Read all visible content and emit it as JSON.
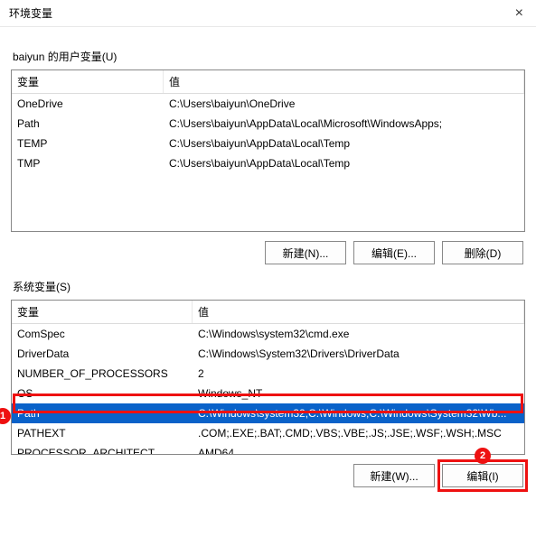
{
  "window": {
    "title": "环境变量",
    "close_glyph": "×"
  },
  "user_vars": {
    "group_label": "baiyun 的用户变量(U)",
    "headers": {
      "variable": "变量",
      "value": "值"
    },
    "rows": [
      {
        "variable": "OneDrive",
        "value": "C:\\Users\\baiyun\\OneDrive"
      },
      {
        "variable": "Path",
        "value": "C:\\Users\\baiyun\\AppData\\Local\\Microsoft\\WindowsApps;"
      },
      {
        "variable": "TEMP",
        "value": "C:\\Users\\baiyun\\AppData\\Local\\Temp"
      },
      {
        "variable": "TMP",
        "value": "C:\\Users\\baiyun\\AppData\\Local\\Temp"
      }
    ],
    "buttons": {
      "new": "新建(N)...",
      "edit": "编辑(E)...",
      "delete": "删除(D)"
    }
  },
  "system_vars": {
    "group_label": "系统变量(S)",
    "headers": {
      "variable": "变量",
      "value": "值"
    },
    "rows": [
      {
        "variable": "ComSpec",
        "value": "C:\\Windows\\system32\\cmd.exe",
        "selected": false
      },
      {
        "variable": "DriverData",
        "value": "C:\\Windows\\System32\\Drivers\\DriverData",
        "selected": false
      },
      {
        "variable": "NUMBER_OF_PROCESSORS",
        "value": "2",
        "selected": false
      },
      {
        "variable": "OS",
        "value": "Windows_NT",
        "selected": false
      },
      {
        "variable": "Path",
        "value": "C:\\Windows\\system32;C:\\Windows;C:\\Windows\\System32\\Wb...",
        "selected": true
      },
      {
        "variable": "PATHEXT",
        "value": ".COM;.EXE;.BAT;.CMD;.VBS;.VBE;.JS;.JSE;.WSF;.WSH;.MSC",
        "selected": false
      },
      {
        "variable": "PROCESSOR_ARCHITECT...",
        "value": "AMD64",
        "selected": false
      }
    ],
    "buttons": {
      "new": "新建(W)...",
      "edit": "编辑(I)"
    }
  },
  "annotations": {
    "marker1": "1",
    "marker2": "2"
  }
}
